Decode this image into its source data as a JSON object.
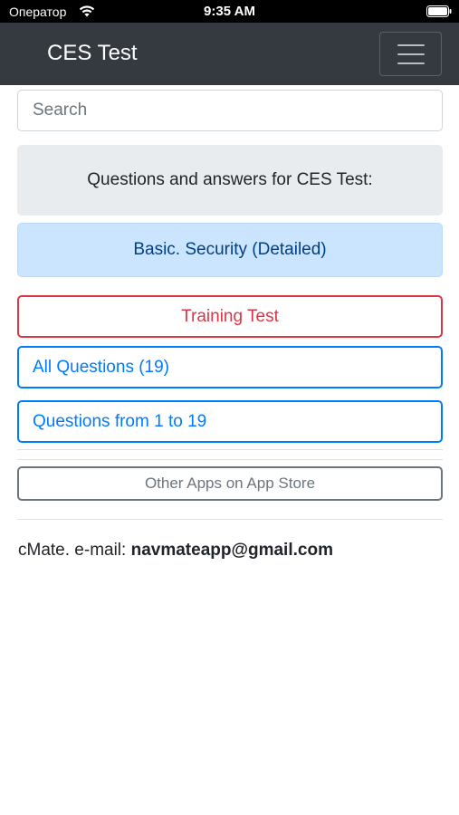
{
  "status_bar": {
    "carrier": "Оператор",
    "time": "9:35 AM"
  },
  "navbar": {
    "title": "CES Test",
    "menu_icon": "hamburger-menu-icon"
  },
  "search": {
    "placeholder": "Search"
  },
  "intro": {
    "text": "Questions and answers for CES Test:"
  },
  "section": {
    "title": "Basic. Security (Detailed)"
  },
  "buttons": {
    "training_test": "Training Test",
    "all_questions": "All Questions (19)",
    "questions_range": "Questions from 1 to 19",
    "other_apps": "Other Apps on App Store"
  },
  "footer": {
    "label": "cMate. e-mail:",
    "email": "navmateapp@gmail.com"
  },
  "colors": {
    "navbar_bg": "#343a40",
    "danger": "#dc3545",
    "primary": "#007bff",
    "secondary": "#6c757d",
    "info_bg": "#cce5ff"
  }
}
